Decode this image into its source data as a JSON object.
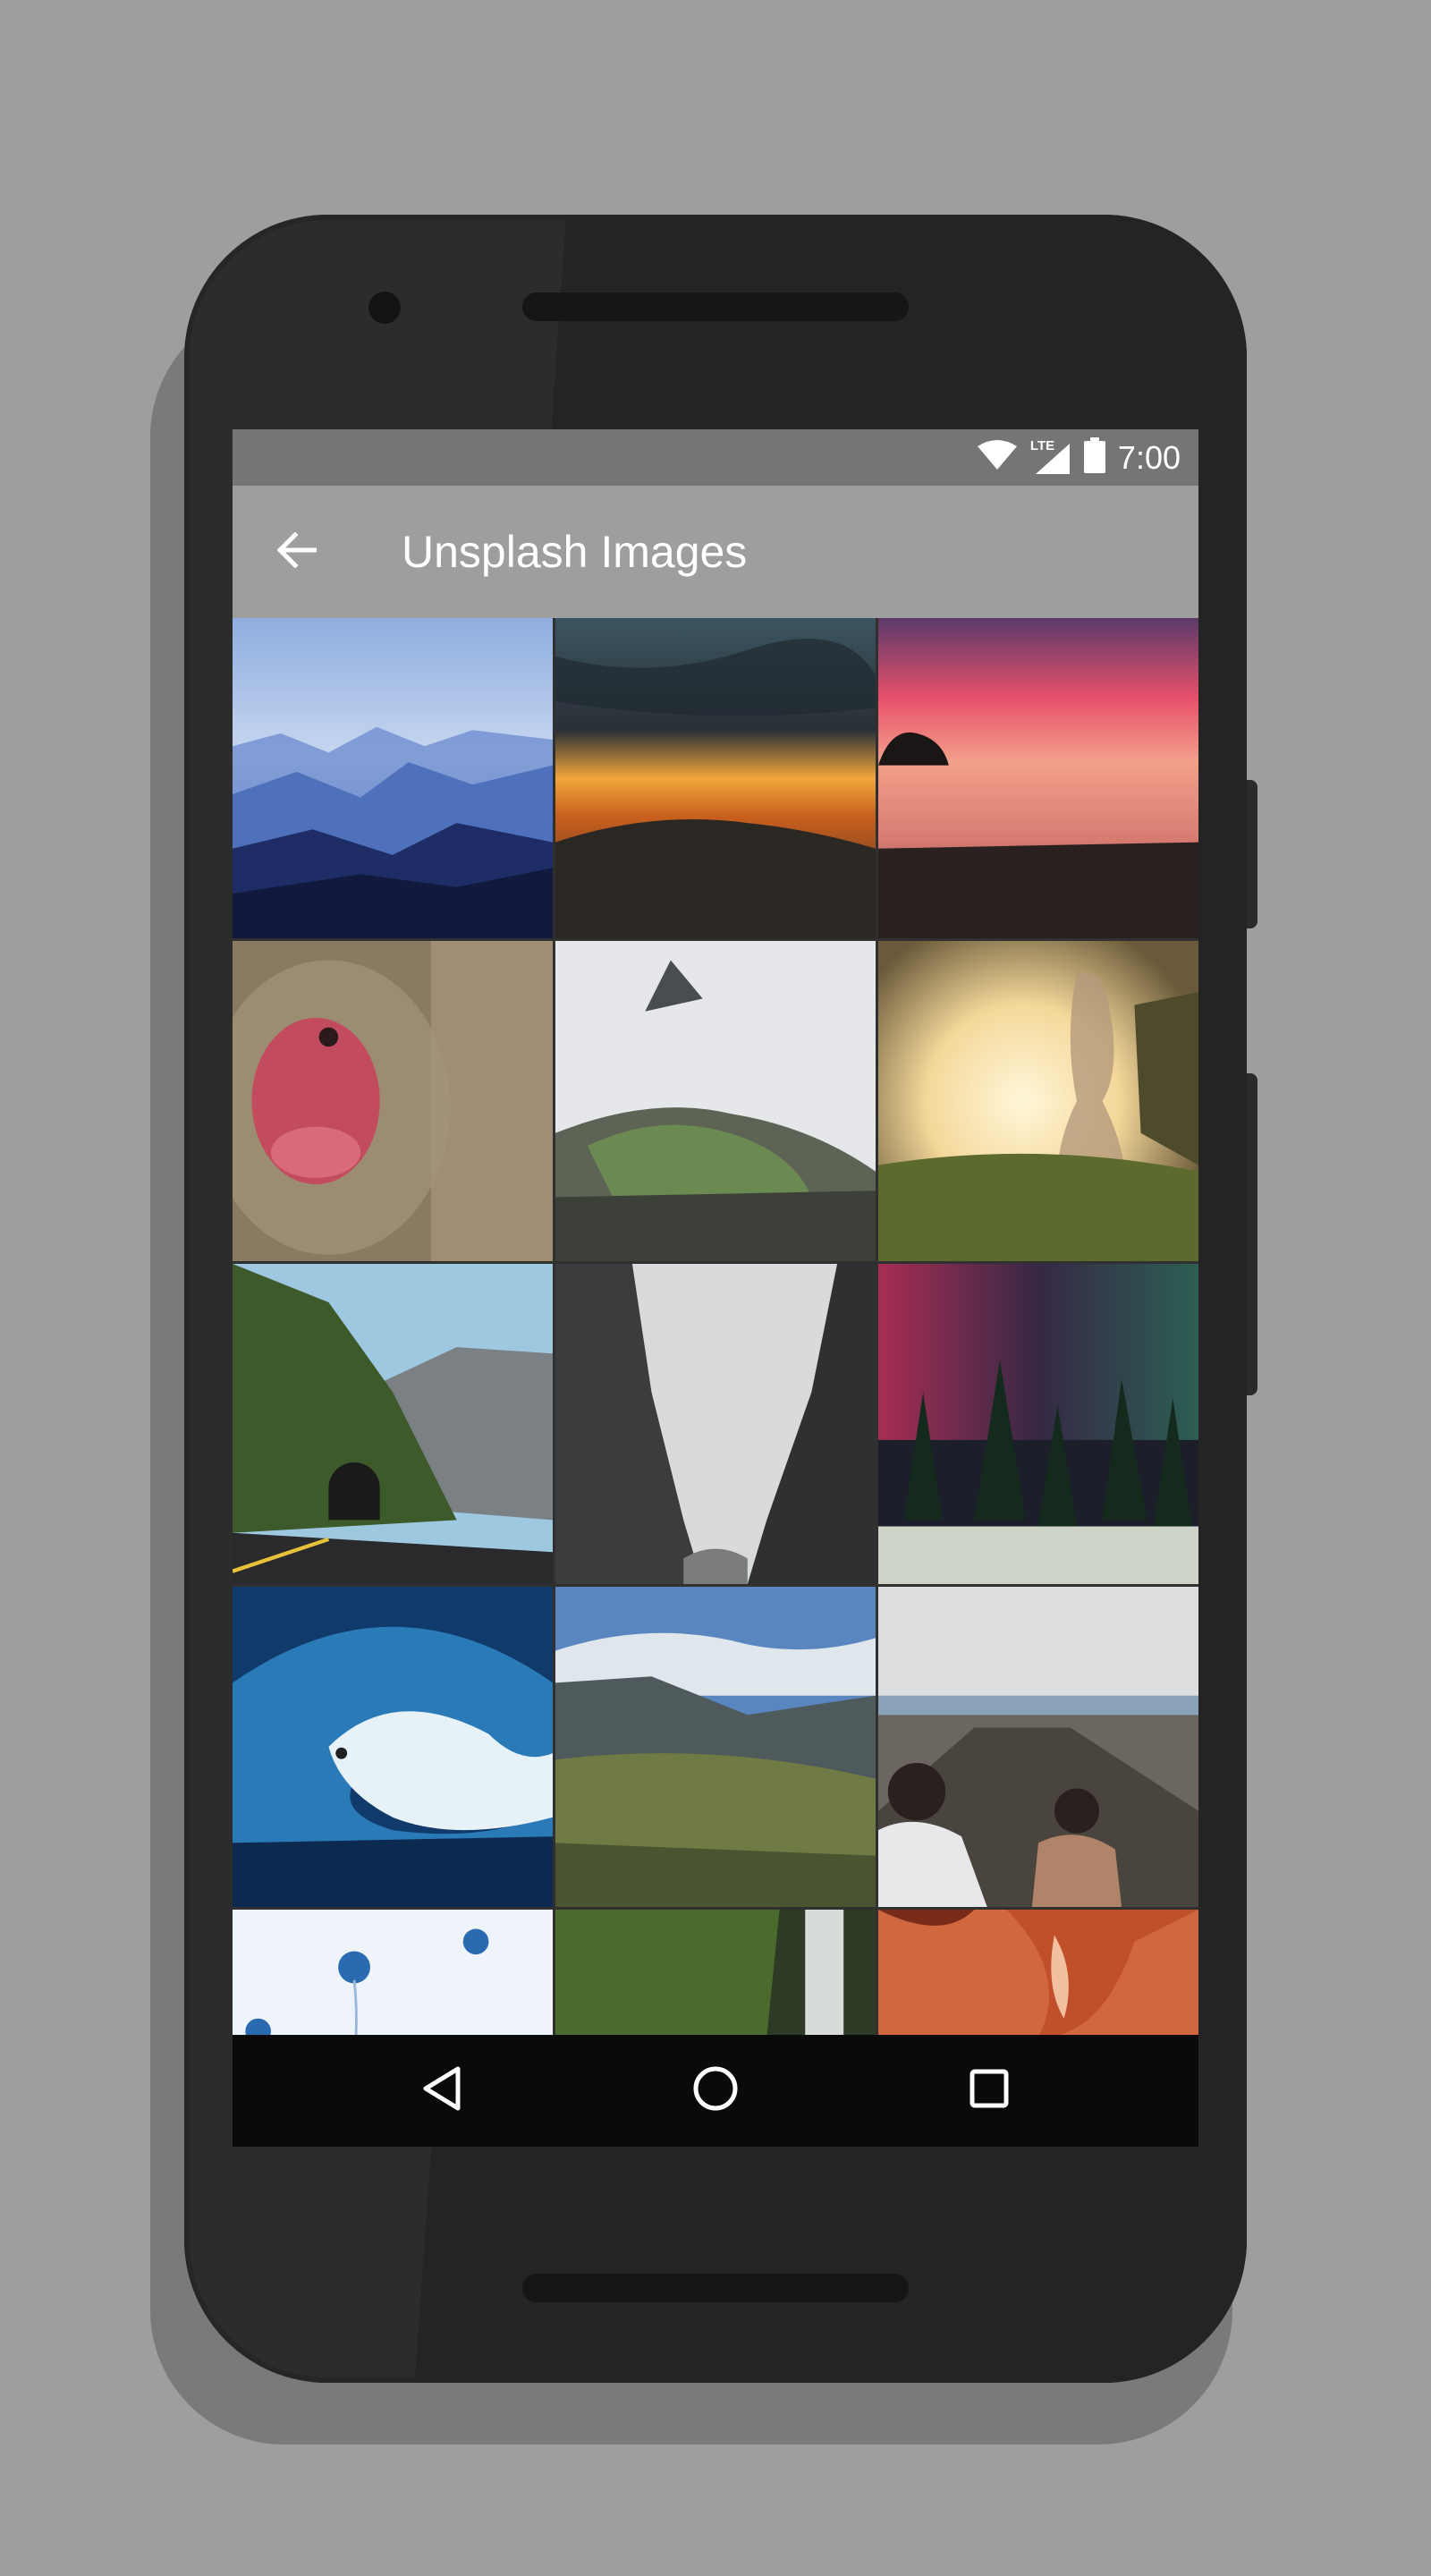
{
  "status_bar": {
    "time": "7:00",
    "network_label": "LTE",
    "icons": [
      "wifi-icon",
      "cellular-signal-icon",
      "battery-icon"
    ]
  },
  "app_bar": {
    "title": "Unsplash Images",
    "navigation_icon": "arrow-back-icon"
  },
  "images": [
    {
      "subject": "misty blue mountain ranges"
    },
    {
      "subject": "dark clouds over orange sunset and hills"
    },
    {
      "subject": "pink sunset over beach with rock"
    },
    {
      "subject": "snow monkey red face close-up"
    },
    {
      "subject": "machu picchu ruins in clouds"
    },
    {
      "subject": "girl silhouette in bright sunlight in grass"
    },
    {
      "subject": "mountain road with tunnel"
    },
    {
      "subject": "foggy canyon cliffs with river"
    },
    {
      "subject": "northern lights over pine forest"
    },
    {
      "subject": "surfer inside big blue wave"
    },
    {
      "subject": "green mountain valley with waterfall"
    },
    {
      "subject": "crowd on boardwalk pier by the sea"
    },
    {
      "subject": "blue jellyfish on white"
    },
    {
      "subject": "mossy cliff with waterfall"
    },
    {
      "subject": "orange sandstone slot canyon"
    }
  ],
  "nav_bar": {
    "buttons": [
      "back-triangle-icon",
      "home-circle-icon",
      "recents-square-icon"
    ]
  },
  "colors": {
    "background": "#9e9e9e",
    "status_bar": "#757575",
    "app_bar": "#9e9e9e",
    "nav_bar": "#0a0a0a",
    "phone_body": "#2c2c2c"
  }
}
